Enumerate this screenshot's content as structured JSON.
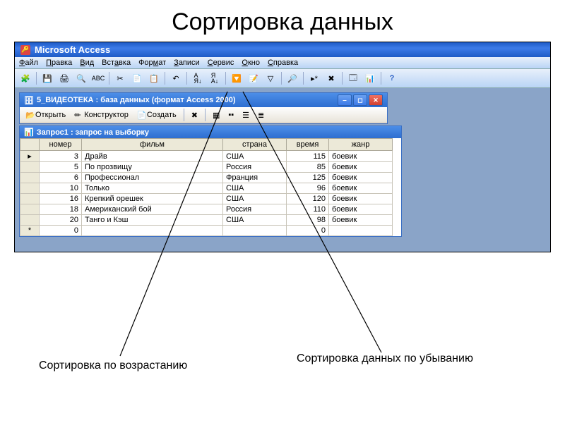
{
  "slide": {
    "title": "Сортировка данных"
  },
  "app": {
    "title": "Microsoft Access"
  },
  "menu": {
    "items": [
      "Файл",
      "Правка",
      "Вид",
      "Вставка",
      "Формат",
      "Записи",
      "Сервис",
      "Окно",
      "Справка"
    ],
    "underline_idx": [
      0,
      0,
      0,
      3,
      3,
      0,
      0,
      0,
      0
    ]
  },
  "dbwin": {
    "title": "5_ВИДЕОТЕКА : база данных (формат Access 2000)",
    "toolbar": {
      "open": "Открыть",
      "design": "Конструктор",
      "create": "Создать"
    }
  },
  "querywin": {
    "title": "Запрос1 : запрос на выборку"
  },
  "grid": {
    "headers": [
      "номер",
      "фильм",
      "страна",
      "время",
      "жанр"
    ],
    "rows": [
      {
        "num": 3,
        "film": "Драйв",
        "country": "США",
        "time": 115,
        "genre": "боевик",
        "cursor": true
      },
      {
        "num": 5,
        "film": "По прозвищу",
        "country": "Россия",
        "time": 85,
        "genre": "боевик"
      },
      {
        "num": 6,
        "film": "Профессионал",
        "country": "Франция",
        "time": 125,
        "genre": "боевик"
      },
      {
        "num": 10,
        "film": "Только",
        "country": "США",
        "time": 96,
        "genre": "боевик"
      },
      {
        "num": 16,
        "film": "Крепкий орешек",
        "country": "США",
        "time": 120,
        "genre": "боевик"
      },
      {
        "num": 18,
        "film": "Американский бой",
        "country": "Россия",
        "time": 110,
        "genre": "боевик"
      },
      {
        "num": 20,
        "film": "Танго и Кэш",
        "country": "США",
        "time": 98,
        "genre": "боевик"
      },
      {
        "num": 0,
        "film": "",
        "country": "",
        "time": 0,
        "genre": "",
        "new": true
      }
    ]
  },
  "callouts": {
    "asc": "Сортировка по возрастанию",
    "desc": "Сортировка данных по убыванию"
  },
  "icons": {
    "sort_asc": "A↓",
    "sort_desc": "A↑"
  },
  "chart_data": {
    "type": "table",
    "title": "Запрос1 : запрос на выборку",
    "columns": [
      "номер",
      "фильм",
      "страна",
      "время",
      "жанр"
    ],
    "rows": [
      [
        3,
        "Драйв",
        "США",
        115,
        "боевик"
      ],
      [
        5,
        "По прозвищу",
        "Россия",
        85,
        "боевик"
      ],
      [
        6,
        "Профессионал",
        "Франция",
        125,
        "боевик"
      ],
      [
        10,
        "Только",
        "США",
        96,
        "боевик"
      ],
      [
        16,
        "Крепкий орешек",
        "США",
        120,
        "боевик"
      ],
      [
        18,
        "Американский бой",
        "Россия",
        110,
        "боевик"
      ],
      [
        20,
        "Танго и Кэш",
        "США",
        98,
        "боевик"
      ]
    ]
  }
}
